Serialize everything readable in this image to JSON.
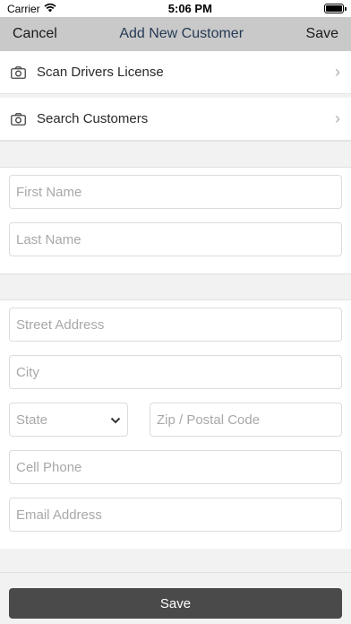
{
  "status": {
    "carrier": "Carrier",
    "time": "5:06 PM"
  },
  "nav": {
    "cancel": "Cancel",
    "title": "Add New Customer",
    "save": "Save"
  },
  "menu": {
    "items": [
      {
        "label": "Scan Drivers License",
        "icon": "camera-icon"
      },
      {
        "label": "Search Customers",
        "icon": "camera-icon"
      }
    ]
  },
  "name_section": {
    "first_name": {
      "placeholder": "First Name",
      "value": ""
    },
    "last_name": {
      "placeholder": "Last Name",
      "value": ""
    }
  },
  "address_section": {
    "street": {
      "placeholder": "Street Address",
      "value": ""
    },
    "city": {
      "placeholder": "City",
      "value": ""
    },
    "state": {
      "placeholder": "State"
    },
    "zip": {
      "placeholder": "Zip / Postal Code",
      "value": ""
    },
    "cell_phone": {
      "placeholder": "Cell Phone",
      "value": ""
    },
    "email": {
      "placeholder": "Email Address",
      "value": ""
    }
  },
  "footer": {
    "save_label": "Save"
  },
  "colors": {
    "nav_bg": "#c9c9c9",
    "title": "#263a55",
    "save_button": "#4a4a4a"
  }
}
